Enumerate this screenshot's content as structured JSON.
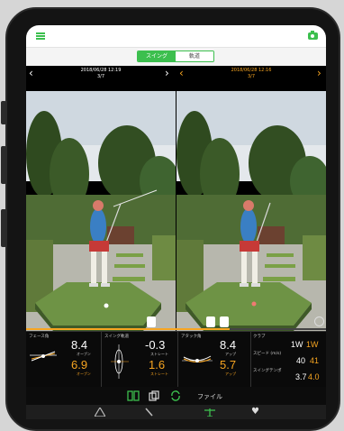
{
  "segment": {
    "swing_label": "スイング",
    "orbit_label": "軌道"
  },
  "left_header": {
    "date": "2018/06/28 12:19",
    "index": "3/7"
  },
  "right_header": {
    "date": "2018/06/28 12:16",
    "index": "3/7"
  },
  "metrics": {
    "face_angle": {
      "label": "フェース角",
      "white": "8.4",
      "white_sub": "オープン",
      "orange": "6.9",
      "orange_sub": "オープン"
    },
    "swing_path": {
      "label": "スイング軌道",
      "white": "-0.3",
      "white_sub": "ストレート",
      "orange": "1.6",
      "orange_sub": "ストレート"
    },
    "attack_angle": {
      "label": "アタック角",
      "white": "8.4",
      "white_sub": "アップ",
      "orange": "5.7",
      "orange_sub": "アップ"
    },
    "club": {
      "label": "クラブ",
      "white": "1W",
      "orange": "1W"
    },
    "speed": {
      "label": "スピード (m/s)",
      "white": "40",
      "orange": "41"
    },
    "tempo": {
      "label": "スイングテンポ",
      "white": "3.7",
      "orange": "4.0"
    }
  },
  "toolbar": {
    "file_label": "ファイル"
  },
  "tabbar": {
    "items": [
      "analysis",
      "compare",
      "adjust",
      "favorite"
    ]
  },
  "colors": {
    "accent": "#3cbf4e",
    "compare": "#f7a521",
    "background": "#000000"
  },
  "playback": {
    "position_fraction": 0.68
  }
}
